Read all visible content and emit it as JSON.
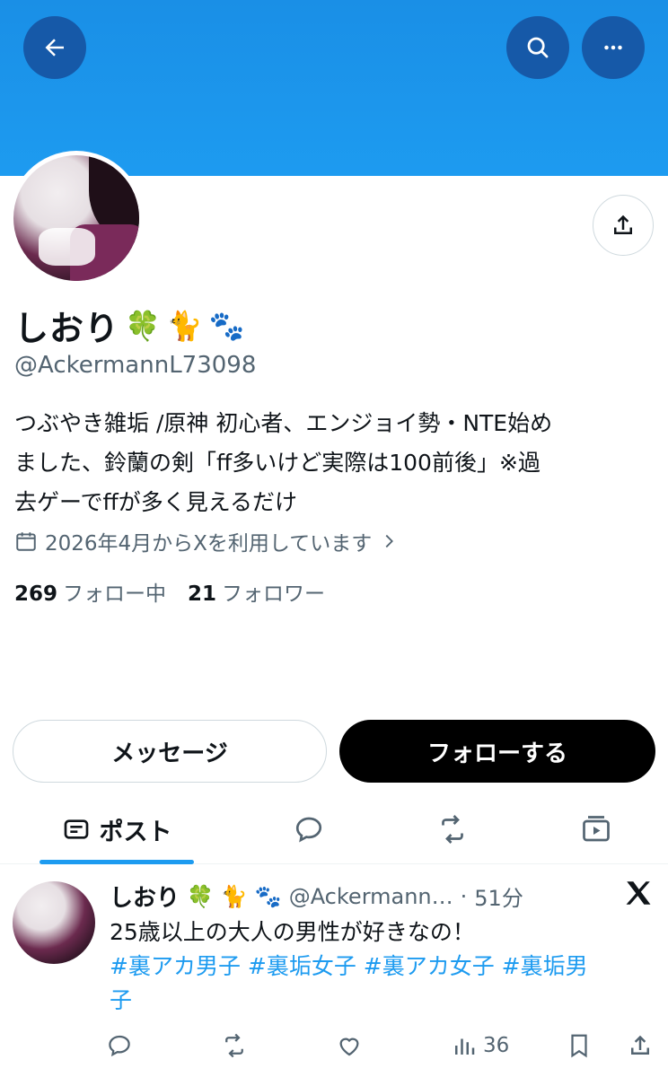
{
  "profile": {
    "name": "しおり",
    "name_emojis": [
      "🍀",
      "🐈",
      "🐾"
    ],
    "handle": "@AckermannL73098",
    "bio_line1": "つぶやき雑垢 /原神 初心者、エンジョイ勢・NTE始め",
    "bio_line2": "ました、鈴蘭の剣「ff多いけど実際は100前後」※過",
    "bio_line3": "去ゲーでffが多く見えるだけ",
    "joined": "2026年4月からXを利用しています",
    "following_count": "269",
    "following_label": "フォロー中",
    "followers_count": "21",
    "followers_label": "フォロワー"
  },
  "buttons": {
    "message": "メッセージ",
    "follow": "フォローする"
  },
  "tabs": {
    "posts": "ポスト"
  },
  "post": {
    "name": "しおり",
    "emojis": [
      "🍀",
      "🐈",
      "🐾"
    ],
    "handle": "@Ackermann…",
    "separator": "·",
    "time": "51分",
    "text": "25歳以上の大人の男性が好きなの！",
    "hashtags_line1": "#裏アカ男子 #裏垢女子 #裏アカ女子 #裏垢男",
    "hashtags_line2": "子",
    "views": "36"
  },
  "icons": [
    "back-arrow-icon",
    "search-icon",
    "more-icon",
    "share-icon",
    "calendar-icon",
    "chevron-right-icon",
    "posts-tab-icon",
    "reply-icon",
    "repost-icon",
    "media-icon",
    "x-logo-icon",
    "like-icon",
    "views-icon",
    "bookmark-icon"
  ],
  "colors": {
    "banner": "#1d9bf0",
    "accent": "#1d9bf0",
    "button_dark": "#000000",
    "muted": "#536471"
  }
}
